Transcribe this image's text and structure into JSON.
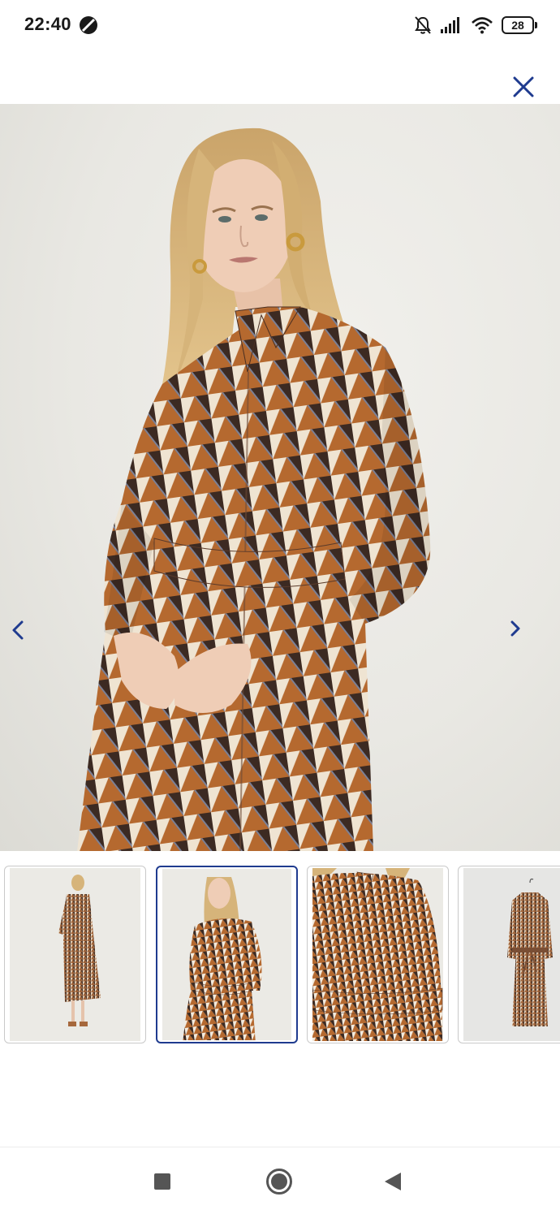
{
  "status_bar": {
    "time": "22:40",
    "left_icon": "do-not-disturb-icon",
    "icons": [
      "notifications-muted-icon",
      "cellular-signal-icon",
      "wifi-icon",
      "battery-icon"
    ],
    "battery_level": "28"
  },
  "viewer": {
    "close_icon": "close-icon",
    "prev_icon": "chevron-left-icon",
    "next_icon": "chevron-right-icon",
    "accent_color": "#1f3b8f",
    "pattern_colors": [
      "#b5692f",
      "#f3ebde",
      "#3c2a22",
      "#7d8299"
    ],
    "active_index": 1,
    "thumbnails": [
      {
        "view": "full-length-front"
      },
      {
        "view": "half-body-front"
      },
      {
        "view": "detail-closeup"
      },
      {
        "view": "on-hanger"
      }
    ]
  },
  "navigation_bar": {
    "buttons": [
      "recents-square-icon",
      "home-circle-icon",
      "back-triangle-icon"
    ]
  }
}
